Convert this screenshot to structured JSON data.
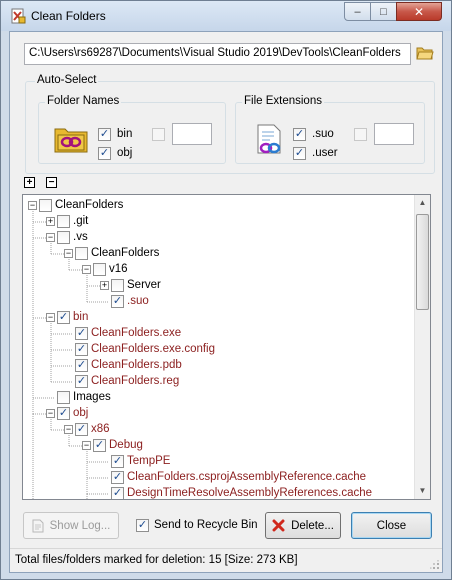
{
  "window": {
    "title": "Clean Folders",
    "minimize": "‒",
    "maximize": "□",
    "close": "✕"
  },
  "path": {
    "value": "C:\\Users\\rs69287\\Documents\\Visual Studio 2019\\DevTools\\CleanFolders"
  },
  "auto_select": {
    "label": "Auto-Select",
    "folder_names": {
      "label": "Folder Names",
      "items": [
        {
          "label": "bin",
          "checked": true
        },
        {
          "label": "obj",
          "checked": true
        }
      ],
      "custom_checked": false,
      "custom_value": ""
    },
    "file_extensions": {
      "label": "File Extensions",
      "items": [
        {
          "label": ".suo",
          "checked": true
        },
        {
          "label": ".user",
          "checked": true
        }
      ],
      "custom_checked": false,
      "custom_value": ""
    }
  },
  "tree_controls": {
    "expand_all": "+",
    "collapse_all": "−"
  },
  "tree": {
    "nodes": [
      {
        "label": "CleanFolders",
        "level": 0,
        "expander": "−",
        "checked": false,
        "marked": false
      },
      {
        "label": ".git",
        "level": 1,
        "expander": "+",
        "checked": false,
        "marked": false
      },
      {
        "label": ".vs",
        "level": 1,
        "expander": "−",
        "checked": false,
        "marked": false
      },
      {
        "label": "CleanFolders",
        "level": 2,
        "expander": "−",
        "checked": false,
        "marked": false
      },
      {
        "label": "v16",
        "level": 3,
        "expander": "−",
        "checked": false,
        "marked": false
      },
      {
        "label": "Server",
        "level": 4,
        "expander": "+",
        "checked": false,
        "marked": false
      },
      {
        "label": ".suo",
        "level": 4,
        "expander": "",
        "checked": true,
        "marked": true
      },
      {
        "label": "bin",
        "level": 1,
        "expander": "−",
        "checked": true,
        "marked": true
      },
      {
        "label": "CleanFolders.exe",
        "level": 2,
        "expander": "",
        "checked": true,
        "marked": true
      },
      {
        "label": "CleanFolders.exe.config",
        "level": 2,
        "expander": "",
        "checked": true,
        "marked": true
      },
      {
        "label": "CleanFolders.pdb",
        "level": 2,
        "expander": "",
        "checked": true,
        "marked": true
      },
      {
        "label": "CleanFolders.reg",
        "level": 2,
        "expander": "",
        "checked": true,
        "marked": true
      },
      {
        "label": "Images",
        "level": 1,
        "expander": "",
        "checked": false,
        "marked": false
      },
      {
        "label": "obj",
        "level": 1,
        "expander": "−",
        "checked": true,
        "marked": true
      },
      {
        "label": "x86",
        "level": 2,
        "expander": "−",
        "checked": true,
        "marked": true
      },
      {
        "label": "Debug",
        "level": 3,
        "expander": "−",
        "checked": true,
        "marked": true
      },
      {
        "label": "TempPE",
        "level": 4,
        "expander": "",
        "checked": true,
        "marked": true
      },
      {
        "label": "CleanFolders.csprojAssemblyReference.cache",
        "level": 4,
        "expander": "",
        "checked": true,
        "marked": true
      },
      {
        "label": "DesignTimeResolveAssemblyReferences.cache",
        "level": 4,
        "expander": "",
        "checked": true,
        "marked": true
      }
    ],
    "scroll_up": "▲",
    "scroll_down": "▼"
  },
  "buttons": {
    "show_log": "Show Log...",
    "send_to_recycle": "Send to Recycle Bin",
    "send_to_recycle_checked": true,
    "delete": "Delete...",
    "close": "Close"
  },
  "status": {
    "text": "Total files/folders marked for deletion: 15 [Size: 273 KB]"
  },
  "colors": {
    "marked_text": "#8b1e1e",
    "check_color": "#1d4b8f"
  }
}
